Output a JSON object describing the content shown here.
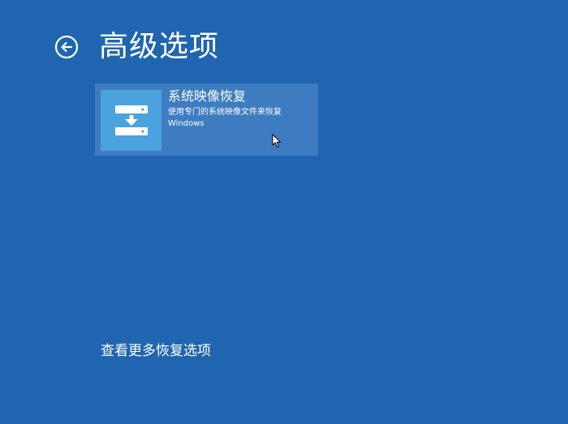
{
  "header": {
    "back_icon": "back-arrow-circle-icon",
    "title": "高级选项"
  },
  "option": {
    "icon": "system-image-recovery-icon",
    "title": "系统映像恢复",
    "description": "使用专门的系统映像文件来恢复 Windows"
  },
  "footer": {
    "more_options": "查看更多恢复选项"
  },
  "colors": {
    "background": "#1f65b0",
    "tile": "#3d7cc1",
    "tile_icon": "#4aa3df",
    "text": "#ffffff"
  }
}
